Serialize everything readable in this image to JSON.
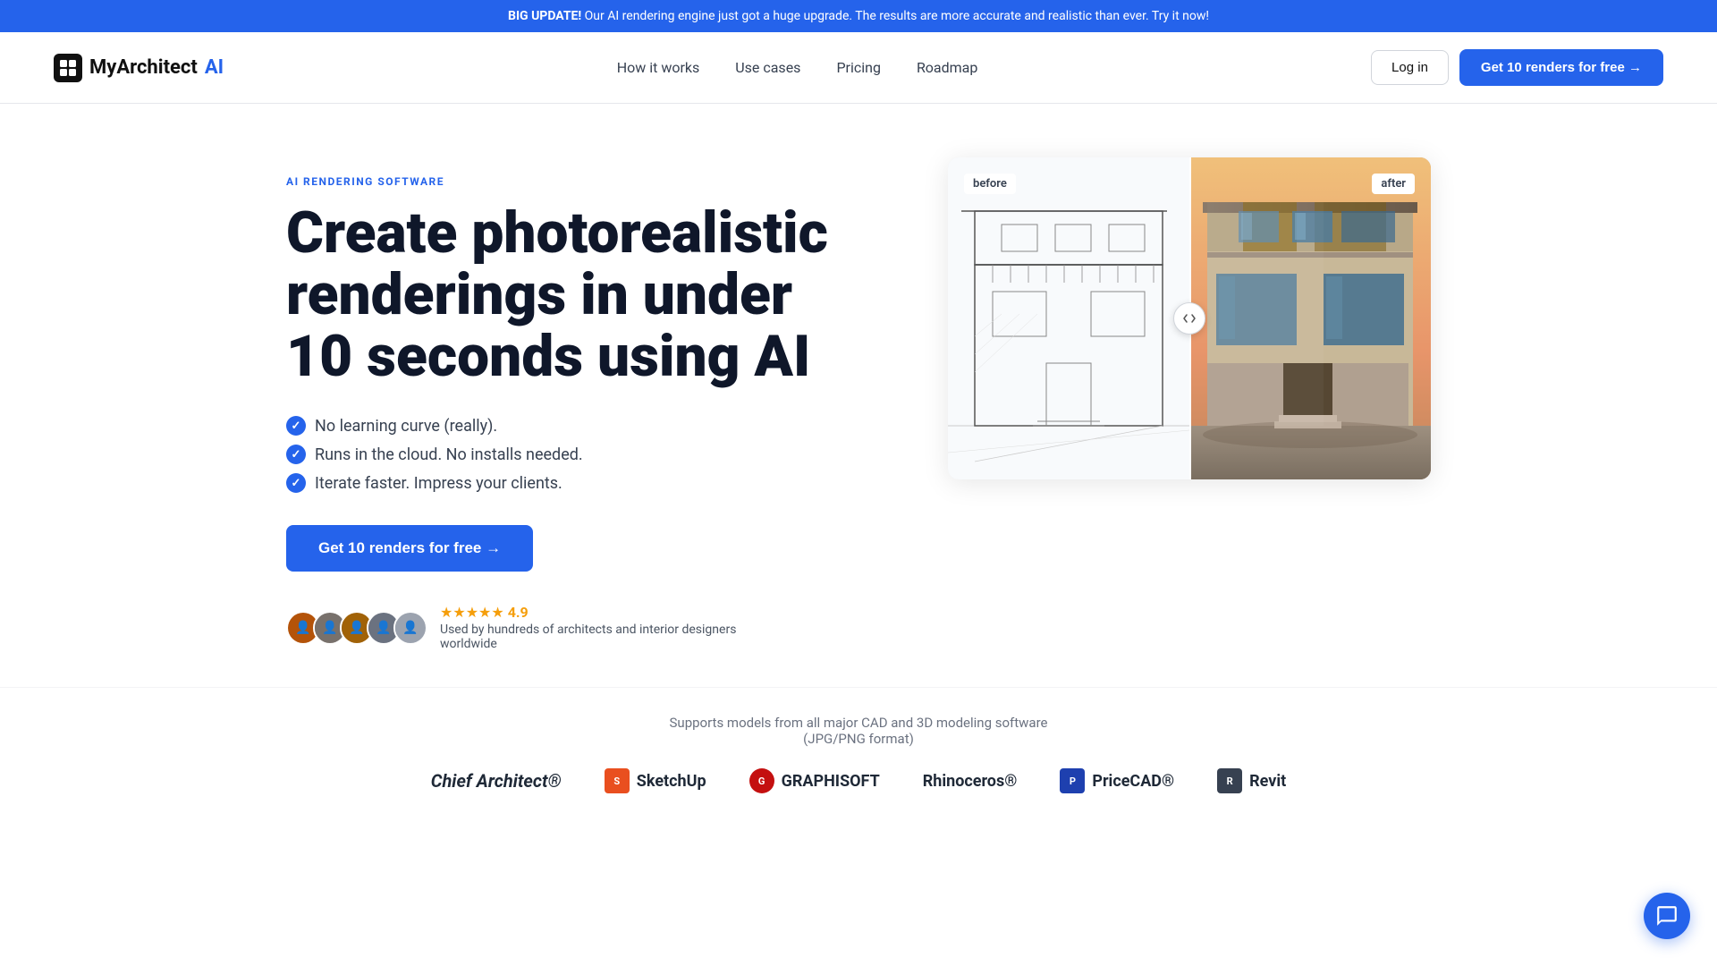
{
  "banner": {
    "bold": "BIG UPDATE!",
    "text": " Our AI rendering engine just got a huge upgrade. The results are more accurate and realistic than ever. Try it now!"
  },
  "nav": {
    "logo_text_main": "MyArchitect",
    "logo_text_ai": "AI",
    "links": [
      {
        "label": "How it works",
        "href": "#"
      },
      {
        "label": "Use cases",
        "href": "#"
      },
      {
        "label": "Pricing",
        "href": "#"
      },
      {
        "label": "Roadmap",
        "href": "#"
      }
    ],
    "login_label": "Log in",
    "cta_label": "Get 10 renders for free →"
  },
  "hero": {
    "tag": "AI RENDERING SOFTWARE",
    "title": "Create photorealistic renderings in under 10 seconds using AI",
    "bullets": [
      "No learning curve (really).",
      "Runs in the cloud. No installs needed.",
      "Iterate faster. Impress your clients."
    ],
    "cta_label": "Get 10 renders for free →",
    "rating": "4.9",
    "social_text_line1": "Used by hundreds of architects and interior designers",
    "social_text_line2": "worldwide",
    "before_label": "before",
    "after_label": "after"
  },
  "supports": {
    "text": "Supports models from all major CAD and 3D modeling software",
    "subtext": "(JPG/PNG format)",
    "logos": [
      {
        "name": "Chief Architect®",
        "icon": "CA"
      },
      {
        "name": "SketchUp",
        "icon": "S"
      },
      {
        "name": "GRAPHISOFT",
        "icon": "G"
      },
      {
        "name": "Rhinoceros®",
        "icon": "R"
      },
      {
        "name": "PriceCAD®",
        "icon": "P"
      },
      {
        "name": "Revit",
        "icon": "R"
      }
    ]
  },
  "colors": {
    "blue": "#2563eb",
    "dark": "#0f172a"
  }
}
